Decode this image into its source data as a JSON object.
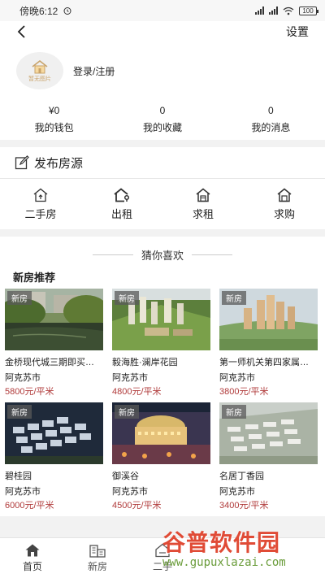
{
  "status_bar": {
    "time": "傍晚6:12",
    "battery": "100"
  },
  "header": {
    "settings_label": "设置"
  },
  "profile": {
    "avatar_caption": "暂无图片",
    "login_label": "登录/注册"
  },
  "stats": [
    {
      "value": "¥0",
      "label": "我的钱包"
    },
    {
      "value": "0",
      "label": "我的收藏"
    },
    {
      "value": "0",
      "label": "我的消息"
    }
  ],
  "publish_label": "发布房源",
  "quick_actions": [
    {
      "label": "二手房",
      "icon": "house-up-icon"
    },
    {
      "label": "出租",
      "icon": "house-key-icon"
    },
    {
      "label": "求租",
      "icon": "house-search-icon"
    },
    {
      "label": "求购",
      "icon": "house-buy-icon"
    }
  ],
  "guess_title": "猜你喜欢",
  "section_title": "新房推荐",
  "listings": [
    {
      "tag": "新房",
      "name": "金桥现代城三期即买…",
      "city": "阿克苏市",
      "price": "5800元/平米",
      "scene": "lake"
    },
    {
      "tag": "新房",
      "name": "毅海胜·澜岸花园",
      "city": "阿克苏市",
      "price": "4800元/平米",
      "scene": "aerial-green"
    },
    {
      "tag": "新房",
      "name": "第一师机关第四家属…",
      "city": "阿克苏市",
      "price": "3800元/平米",
      "scene": "towers"
    },
    {
      "tag": "新房",
      "name": "碧桂园",
      "city": "阿克苏市",
      "price": "6000元/平米",
      "scene": "night-blocks"
    },
    {
      "tag": "新房",
      "name": "御溪谷",
      "city": "阿克苏市",
      "price": "4500元/平米",
      "scene": "night-dome"
    },
    {
      "tag": "新房",
      "name": "名居丁香园",
      "city": "阿克苏市",
      "price": "3400元/平米",
      "scene": "aerial-grey"
    }
  ],
  "tabs": [
    {
      "label": "首页",
      "icon": "home-icon"
    },
    {
      "label": "新房",
      "icon": "building-icon"
    },
    {
      "label": "二手",
      "icon": "sale-house-icon"
    }
  ],
  "watermark": {
    "title": "谷普软件园",
    "url": "www.gupuxlazai.com"
  },
  "colors": {
    "price": "#b03a3a",
    "watermark_red": "#e04b36",
    "watermark_green": "#6a9c3a"
  }
}
